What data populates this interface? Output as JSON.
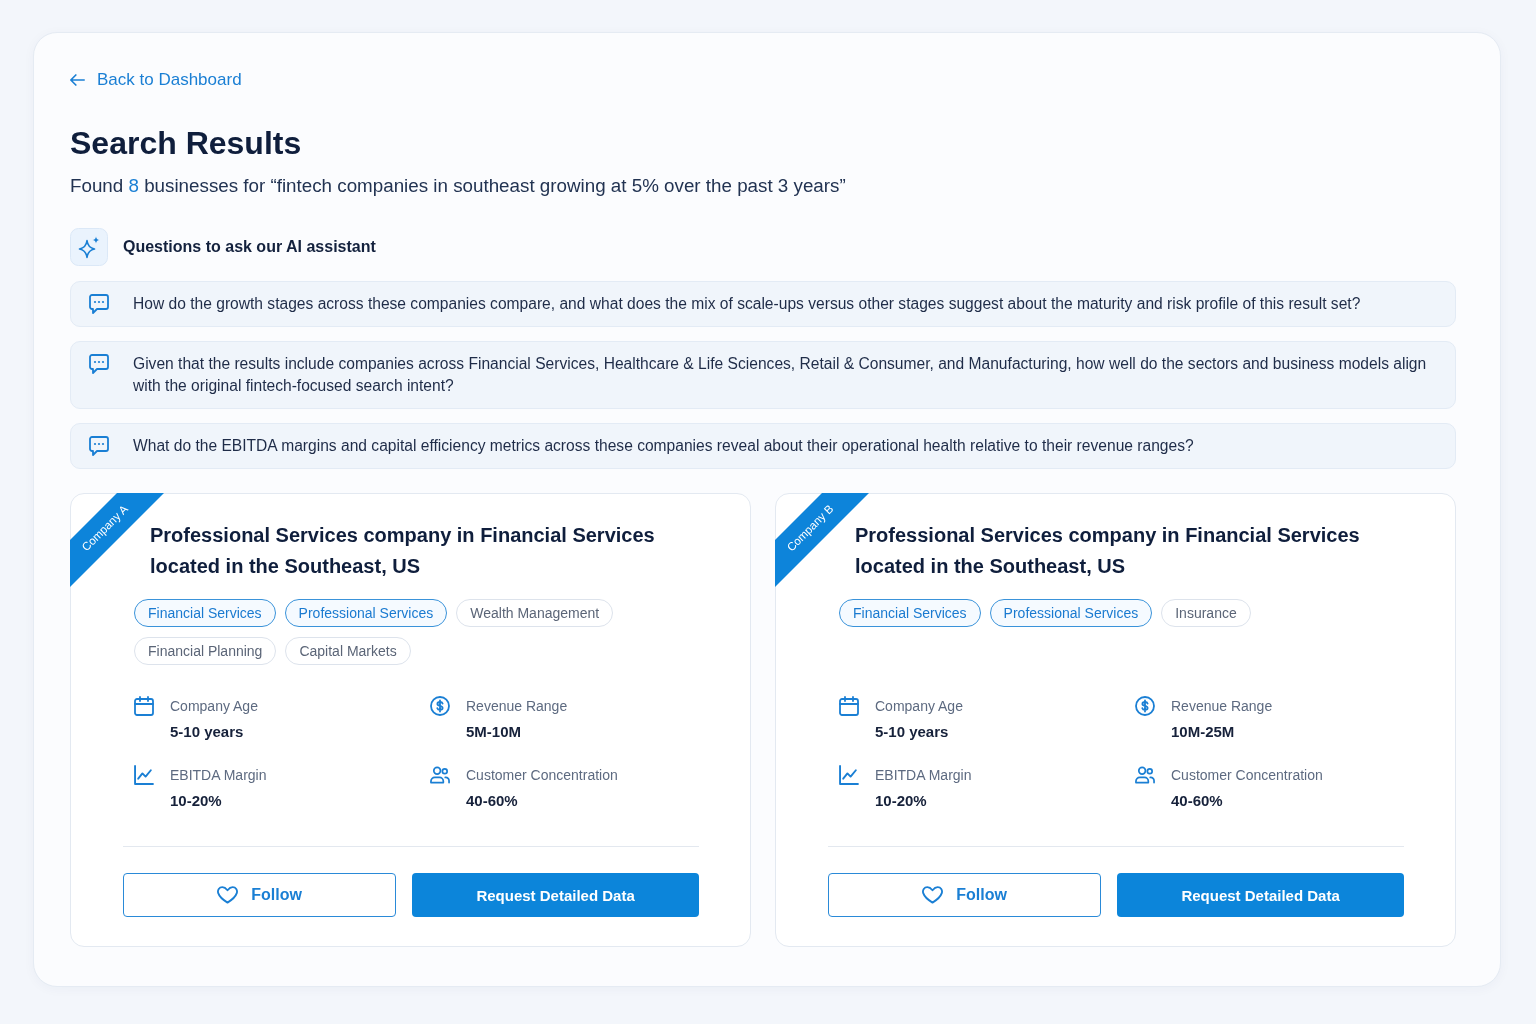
{
  "back_link": {
    "label": "Back to Dashboard"
  },
  "heading": {
    "title": "Search Results",
    "summary": {
      "before": "Found",
      "count": "8",
      "after": "businesses for “fintech companies in southeast growing at 5% over the past 3 years”"
    }
  },
  "assistant": {
    "title": "Questions to ask our AI assistant",
    "questions": [
      "How do the growth stages across these companies compare, and what does the mix of scale-ups versus other stages suggest about the maturity and risk profile of this result set?",
      "Given that the results include companies across Financial Services, Healthcare & Life Sciences, Retail & Consumer, and Manufacturing, how well do the sectors and business models align with the original fintech-focused search intent?",
      "What do the EBITDA margins and capital efficiency metrics across these companies reveal about their operational health relative to their revenue ranges?"
    ]
  },
  "companies": [
    {
      "ribbon": "Company A",
      "title": "Professional Services company in Financial Services located in the Southeast, US",
      "tags": [
        {
          "label": "Financial Services",
          "highlighted": true
        },
        {
          "label": "Professional Services",
          "highlighted": true
        },
        {
          "label": "Wealth Management",
          "highlighted": false
        },
        {
          "label": "Financial Planning",
          "highlighted": false
        },
        {
          "label": "Capital Markets",
          "highlighted": false
        }
      ],
      "metrics": [
        {
          "kind": "age",
          "label": "Company Age",
          "value": "5-10 years"
        },
        {
          "kind": "revenue",
          "label": "Revenue Range",
          "value": "5M-10M"
        },
        {
          "kind": "margin",
          "label": "EBITDA Margin",
          "value": "10-20%"
        },
        {
          "kind": "concentration",
          "label": "Customer Concentration",
          "value": "40-60%"
        }
      ],
      "actions": {
        "follow": "Follow",
        "request": "Request Detailed Data"
      }
    },
    {
      "ribbon": "Company B",
      "title": "Professional Services company in Financial Services located in the Southeast, US",
      "tags": [
        {
          "label": "Financial Services",
          "highlighted": true
        },
        {
          "label": "Professional Services",
          "highlighted": true
        },
        {
          "label": "Insurance",
          "highlighted": false
        }
      ],
      "metrics": [
        {
          "kind": "age",
          "label": "Company Age",
          "value": "5-10 years"
        },
        {
          "kind": "revenue",
          "label": "Revenue Range",
          "value": "10M-25M"
        },
        {
          "kind": "margin",
          "label": "EBITDA Margin",
          "value": "10-20%"
        },
        {
          "kind": "concentration",
          "label": "Customer Concentration",
          "value": "40-60%"
        }
      ],
      "actions": {
        "follow": "Follow",
        "request": "Request Detailed Data"
      }
    }
  ]
}
